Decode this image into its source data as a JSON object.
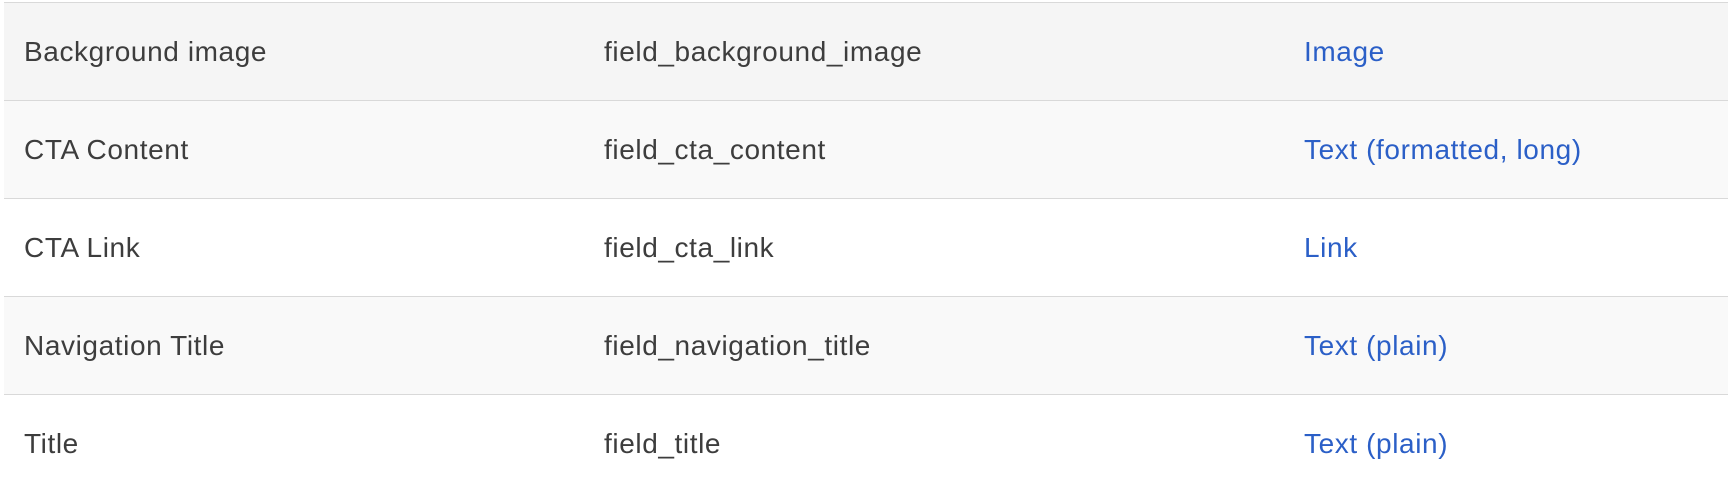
{
  "fields": [
    {
      "label": "Background image",
      "machine_name": "field_background_image",
      "type": "Image"
    },
    {
      "label": "CTA Content",
      "machine_name": "field_cta_content",
      "type": "Text (formatted, long)"
    },
    {
      "label": "CTA Link",
      "machine_name": "field_cta_link",
      "type": "Link"
    },
    {
      "label": "Navigation Title",
      "machine_name": "field_navigation_title",
      "type": "Text (plain)"
    },
    {
      "label": "Title",
      "machine_name": "field_title",
      "type": "Text (plain)"
    }
  ],
  "colors": {
    "text": "#3d3d3d",
    "link": "#2b5fc7",
    "row_shade_dark": "#f5f5f5",
    "row_shade_light": "#f9f9f9",
    "border": "#d9d9d9"
  }
}
